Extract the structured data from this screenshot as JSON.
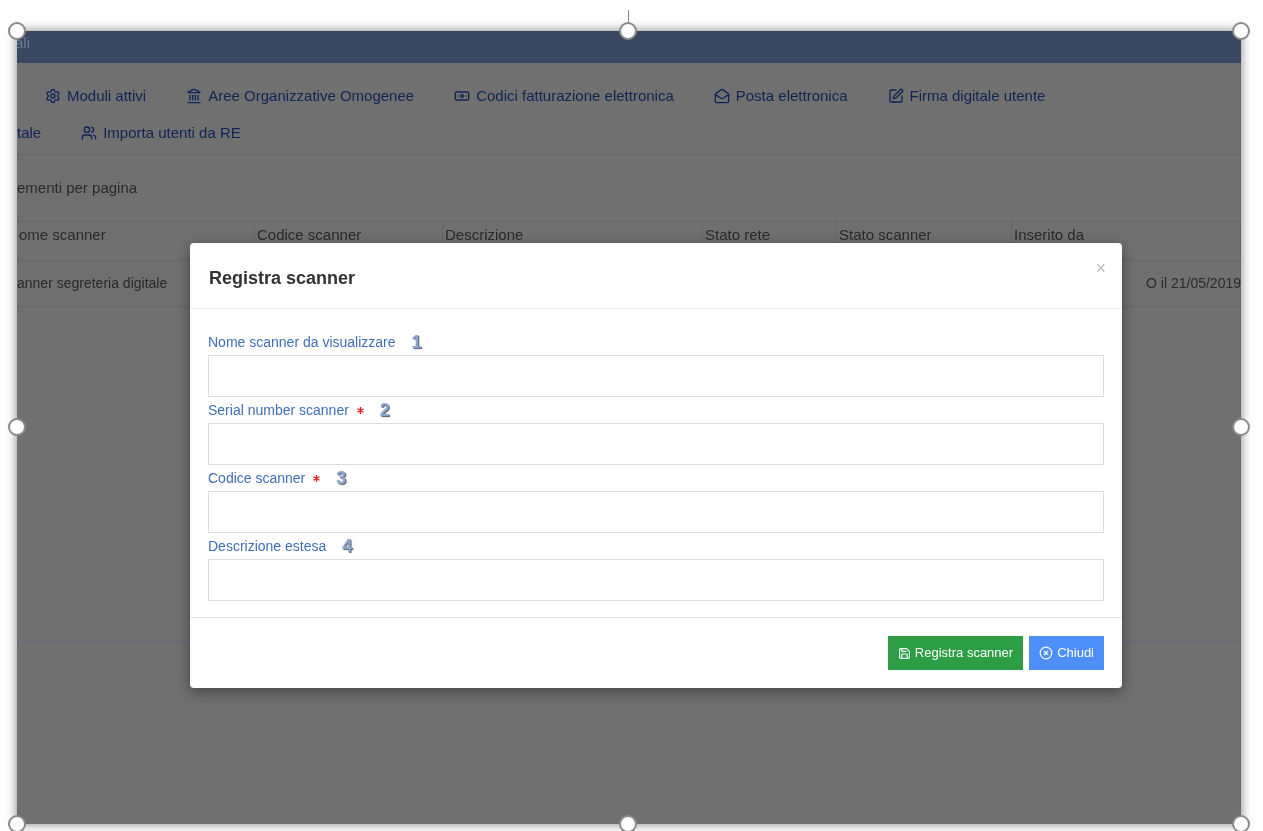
{
  "header": {
    "title": "ali"
  },
  "nav_rows": [
    [
      {
        "label": "Moduli attivi"
      },
      {
        "label": "Aree Organizzative Omogenee"
      },
      {
        "label": "Codici fatturazione elettronica"
      },
      {
        "label": "Posta elettronica"
      },
      {
        "label": "Firma digitale utente"
      }
    ],
    [
      {
        "label": "tale"
      },
      {
        "label": "Importa utenti da RE"
      }
    ]
  ],
  "page_size_label": "ementi per pagina",
  "table": {
    "columns": [
      "ome scanner",
      "Codice scanner",
      "Descrizione",
      "Stato rete",
      "Stato scanner",
      "Inserito da"
    ],
    "rows": [
      [
        "anner segreteria digitale",
        "",
        "",
        "",
        "",
        "O il 21/05/2019"
      ]
    ]
  },
  "dialog": {
    "title": "Registra scanner",
    "close": "×",
    "fields": [
      {
        "label": "Nome scanner da visualizzare",
        "required": false,
        "annotation": "1"
      },
      {
        "label": "Serial number scanner",
        "required": true,
        "annotation": "2"
      },
      {
        "label": "Codice scanner",
        "required": true,
        "annotation": "3"
      },
      {
        "label": "Descrizione estesa",
        "required": false,
        "annotation": "4"
      }
    ],
    "buttons": [
      {
        "label": "Registra scanner",
        "kind": "save"
      },
      {
        "label": "Chiudi",
        "kind": "close"
      }
    ]
  }
}
